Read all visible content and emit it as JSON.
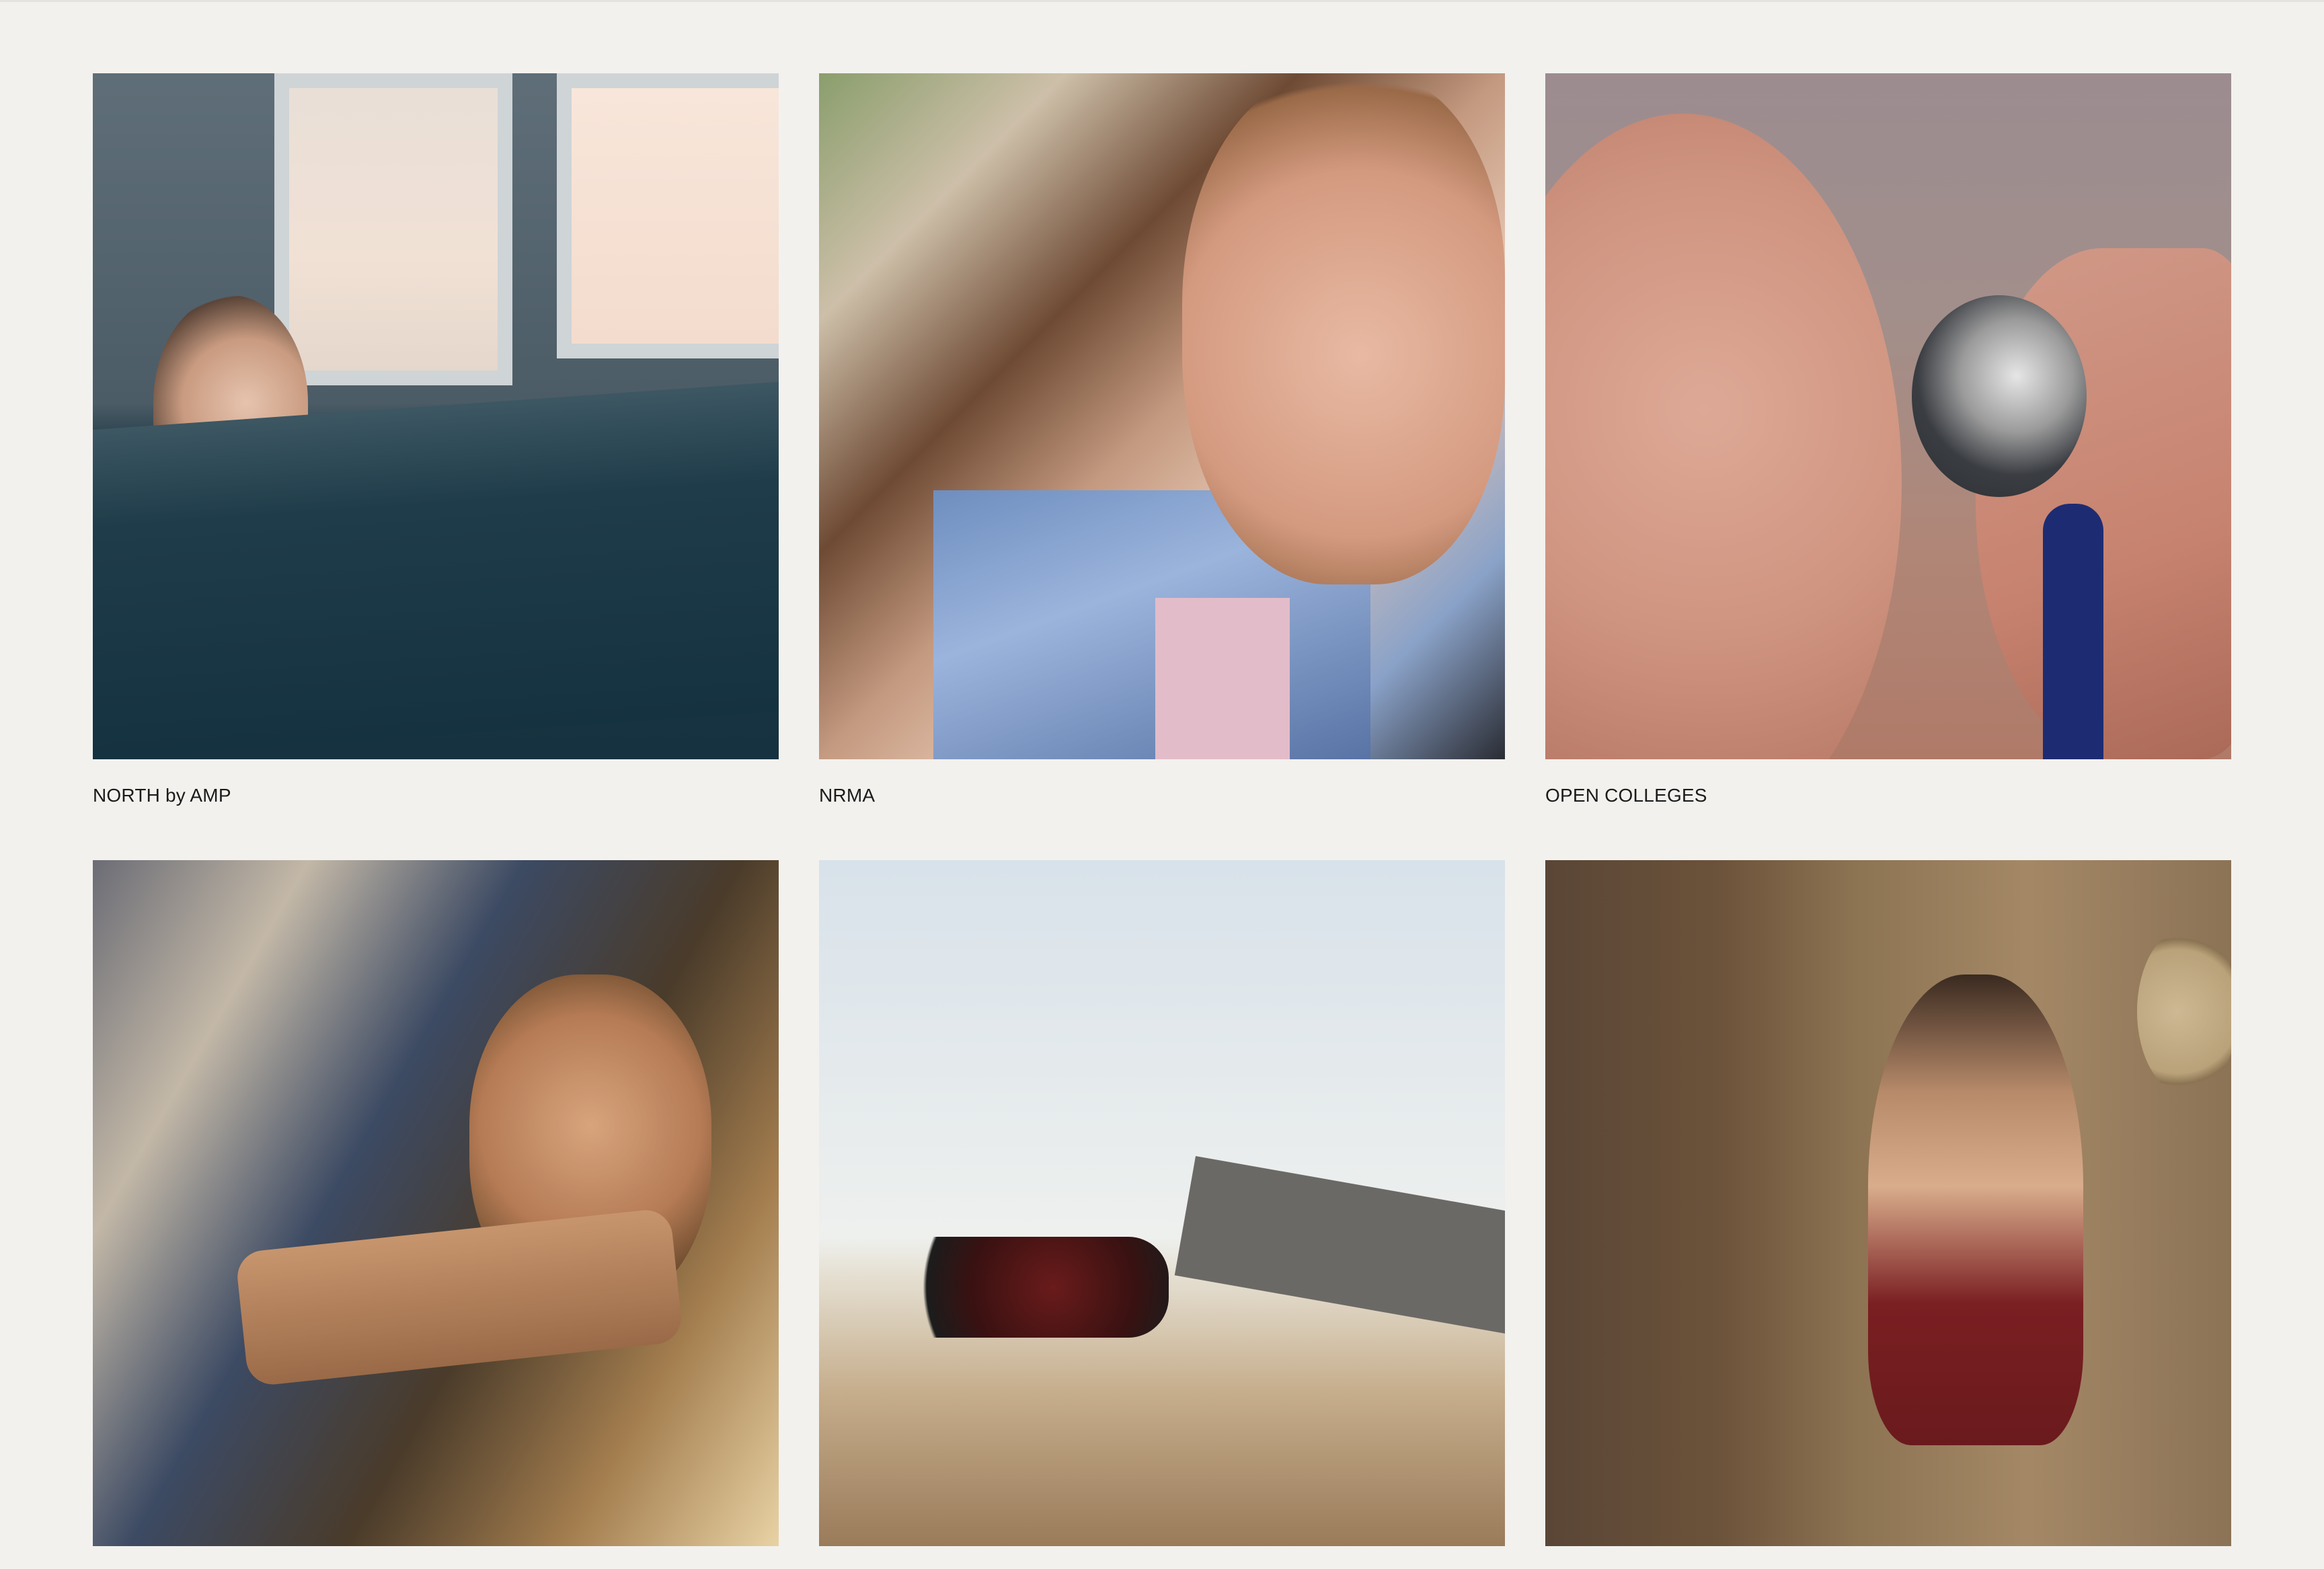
{
  "page": {
    "background_color": "#f2f1ee"
  },
  "projects": [
    {
      "title": "NORTH by AMP",
      "image_icon": "photo-woman-in-bath-with-phone"
    },
    {
      "title": "NRMA",
      "image_icon": "photo-mother-and-son-embrace"
    },
    {
      "title": "OPEN COLLEGES",
      "image_icon": "photo-stethoscope-on-shoulder"
    },
    {
      "title": "",
      "image_icon": "photo-man-laughing-in-car"
    },
    {
      "title": "",
      "image_icon": "photo-motorbike-on-outback-road"
    },
    {
      "title": "",
      "image_icon": "photo-woman-by-brick-wall"
    }
  ]
}
